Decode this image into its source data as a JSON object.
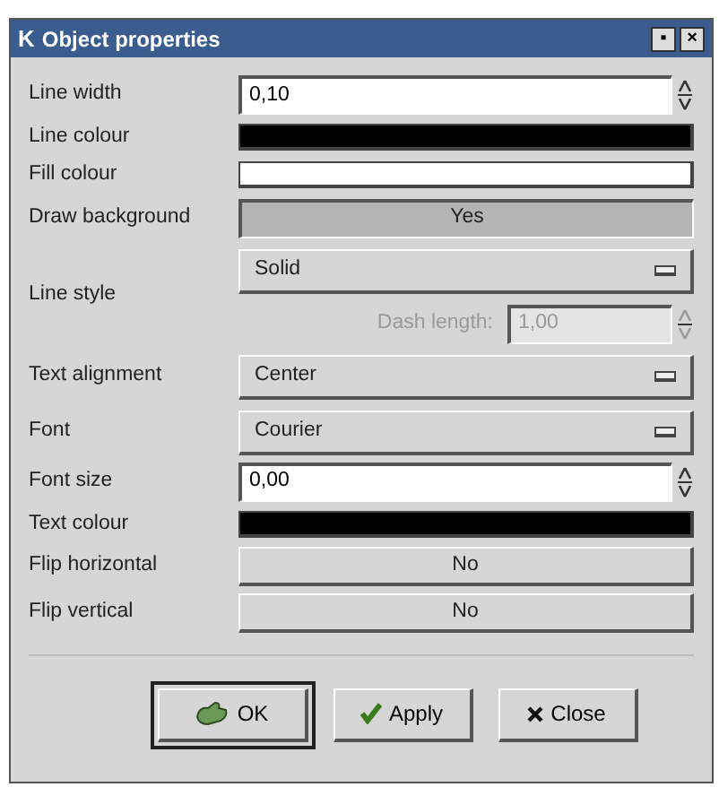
{
  "window": {
    "title": "Object properties",
    "icon": "K",
    "buttons": [
      "▪",
      "×"
    ]
  },
  "rows": [
    {
      "kind": "spin",
      "label": "Line width",
      "value": "0,10"
    },
    {
      "kind": "color",
      "label": "Line colour",
      "color": "#000000"
    },
    {
      "kind": "color",
      "label": "Fill colour",
      "color": "#ffffff"
    },
    {
      "kind": "toggle",
      "label": "Draw background",
      "value": "Yes",
      "on": true
    },
    {
      "kind": "dropdown",
      "label": "Line style",
      "value": "Solid",
      "dash": {
        "label": "Dash length:",
        "value": "1,00",
        "disabled": true
      }
    },
    {
      "kind": "dropdown",
      "label": "Text alignment",
      "value": "Center"
    },
    {
      "kind": "dropdown",
      "label": "Font",
      "value": "Courier"
    },
    {
      "kind": "spin",
      "label": "Font size",
      "value": "0,00"
    },
    {
      "kind": "color",
      "label": "Text colour",
      "color": "#000000"
    },
    {
      "kind": "toggle",
      "label": "Flip horizontal",
      "value": "No",
      "on": false
    },
    {
      "kind": "toggle",
      "label": "Flip vertical",
      "value": "No",
      "on": false
    }
  ],
  "buttons": [
    {
      "kind": "ok",
      "label": "OK",
      "selected": true
    },
    {
      "kind": "apply",
      "label": "Apply",
      "selected": false
    },
    {
      "kind": "close",
      "label": "Close",
      "selected": false
    }
  ]
}
